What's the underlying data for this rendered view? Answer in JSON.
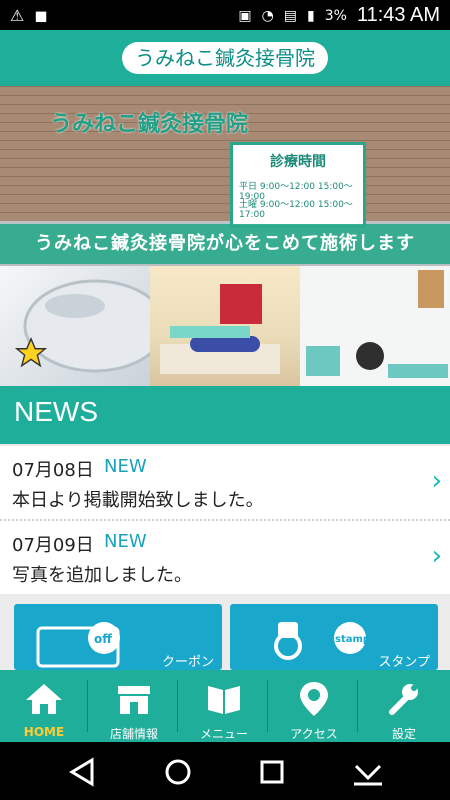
{
  "status_bar": {
    "battery_percent": "3%",
    "time": "11:43 AM"
  },
  "header": {
    "title": "うみねこ鍼灸接骨院"
  },
  "hero": {
    "sign_text": "うみねこ鍼灸接骨院",
    "hours_title": "診療時間",
    "hours_lines": [
      "平日 9:00～12:00  15:00～19:00",
      "土曜 9:00～12:00  15:00～17:00"
    ],
    "banner": "うみねこ鍼灸接骨院が心をこめて施術します"
  },
  "news": {
    "title": "NEWS",
    "items": [
      {
        "date": "07月08日",
        "badge": "NEW",
        "text": "本日より掲載開始致しました。"
      },
      {
        "date": "07月09日",
        "badge": "NEW",
        "text": "写真を追加しました。"
      }
    ]
  },
  "tiles": [
    {
      "label": "クーポン",
      "icon": "coupon-icon"
    },
    {
      "label": "スタンプ",
      "icon": "stamp-icon"
    }
  ],
  "bottom_nav": [
    {
      "label": "HOME",
      "icon": "home-icon",
      "active": true
    },
    {
      "label": "店舗情報",
      "icon": "shop-icon",
      "active": false
    },
    {
      "label": "メニュー",
      "icon": "menu-book-icon",
      "active": false
    },
    {
      "label": "アクセス",
      "icon": "location-pin-icon",
      "active": false
    },
    {
      "label": "設定",
      "icon": "wrench-icon",
      "active": false
    }
  ],
  "colors": {
    "brand": "#1fae9a",
    "accent_new": "#1aa2b8",
    "active_nav": "#ffcc33",
    "tile": "#1aa7cc"
  }
}
